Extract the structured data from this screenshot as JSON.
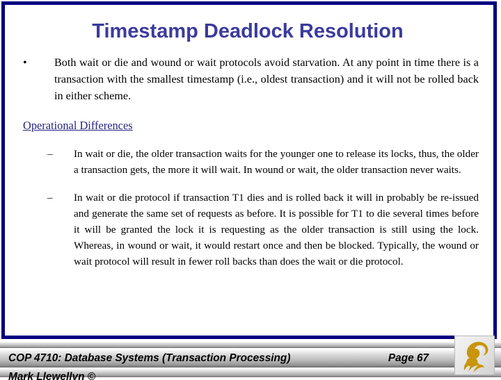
{
  "slide": {
    "title": "Timestamp Deadlock Resolution",
    "border_color": "#000080",
    "title_color": "#3b3b9e",
    "background_color": "#ffffff"
  },
  "content": {
    "bullets": [
      {
        "level": 1,
        "marker": "•",
        "text": "Both wait or die and wound or wait protocols avoid starvation.  At any point in time there is a transaction with the smallest timestamp (i.e., oldest transaction) and it will not be rolled back in either scheme."
      }
    ],
    "section_heading": {
      "text": "Operational Differences",
      "color": "#252585",
      "underlined": true
    },
    "sub_bullets": [
      {
        "level": 2,
        "marker": "–",
        "text": "In wait or die, the older transaction waits for the younger one to release its locks, thus, the older a transaction gets, the more it will wait.  In wound or wait, the older transaction never waits."
      },
      {
        "level": 2,
        "marker": "–",
        "text": "In wait or die protocol if transaction T1 dies and is rolled back it will in probably be re-issued and generate the same set of requests as before.  It is possible for T1 to die several times before it will be granted the lock it is requesting as the older transaction is still using the lock.  Whereas, in wound or wait, it would restart once and then be blocked.  Typically, the wound or wait protocol will result in fewer roll backs than does the wait or die protocol."
      }
    ]
  },
  "footer": {
    "course_line": "COP 4710: Database Systems  (Transaction Processing)",
    "page_label": "Page 67",
    "author_line": "Mark Llewellyn ©",
    "logo_name": "ucf-pegasus-logo",
    "logo_color": "#c8960c"
  }
}
